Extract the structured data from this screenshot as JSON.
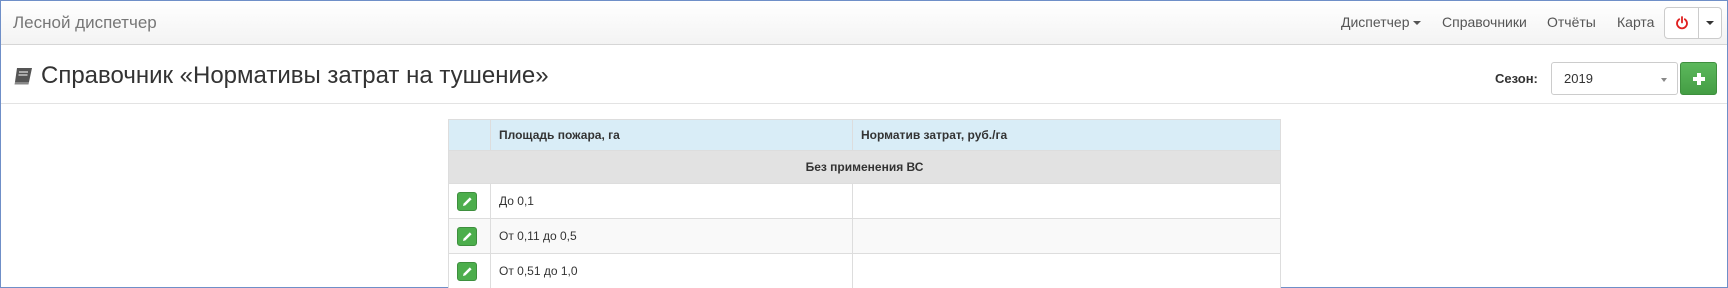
{
  "app": {
    "brand": "Лесной диспетчер"
  },
  "nav": {
    "items": [
      {
        "label": "Диспетчер",
        "has_caret": true
      },
      {
        "label": "Справочники"
      },
      {
        "label": "Отчёты"
      },
      {
        "label": "Карта"
      }
    ],
    "power_icon": "power-icon",
    "power_color": "#e02020"
  },
  "page": {
    "title": "Справочник «Нормативы затрат на тушение»",
    "title_icon": "book-icon"
  },
  "season": {
    "label": "Сезон:",
    "value": "2019"
  },
  "add_button": {
    "icon": "plus-icon",
    "color": "#5cb85c"
  },
  "table": {
    "headers": [
      "",
      "Площадь пожара, га",
      "Норматив затрат, руб./га"
    ],
    "group_label": "Без применения ВС",
    "rows": [
      {
        "area": "До 0,1",
        "cost": ""
      },
      {
        "area": "От 0,11 до 0,5",
        "cost": ""
      },
      {
        "area": "От 0,51 до 1,0",
        "cost": ""
      }
    ],
    "header_color": "#d9edf7",
    "group_color": "#e2e2e2"
  }
}
